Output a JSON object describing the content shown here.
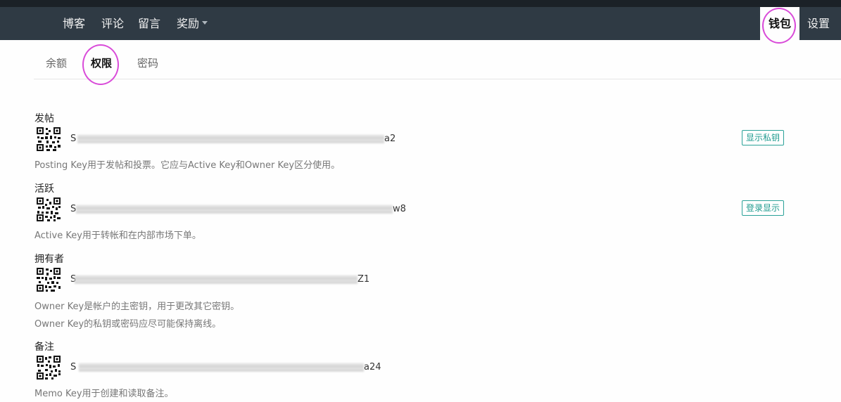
{
  "nav": {
    "items": [
      {
        "label": "博客"
      },
      {
        "label": "评论"
      },
      {
        "label": "留言"
      },
      {
        "label": "奖励"
      }
    ],
    "wallet_label": "钱包",
    "settings_label": "设置"
  },
  "tabs": [
    {
      "label": "余额"
    },
    {
      "label": "权限"
    },
    {
      "label": "密码"
    }
  ],
  "sections": {
    "posting": {
      "title": "发帖",
      "key_prefix": "S",
      "key_suffix": "a2",
      "button": "显示私钥",
      "desc": "Posting Key用于发帖和投票。它应与Active Key和Owner Key区分使用。"
    },
    "active": {
      "title": "活跃",
      "key_prefix": "S",
      "key_suffix": "w8",
      "button": "登录显示",
      "desc": "Active Key用于转帐和在内部市场下单。"
    },
    "owner": {
      "title": "拥有者",
      "key_prefix": "S",
      "key_suffix": "Z1",
      "desc1": "Owner Key是帐户的主密钥，用于更改其它密钥。",
      "desc2": "Owner Key的私钥或密码应尽可能保持离线。"
    },
    "memo": {
      "title": "备注",
      "key_prefix": "S",
      "key_suffix": "a24",
      "desc": "Memo Key用于创建和读取备注。"
    }
  },
  "colors": {
    "nav_bg": "#2f3a44",
    "highlight_circle": "#d94bd9",
    "button_accent": "#1f9b8f"
  },
  "icons": {
    "qr": "qr-code-icon",
    "caret": "caret-down-icon"
  }
}
